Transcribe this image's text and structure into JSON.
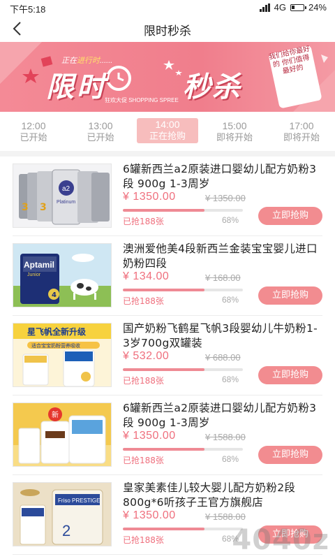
{
  "status_bar": {
    "time": "下午5:18",
    "network": "4G",
    "battery": "24%",
    "battery_level": 0.24
  },
  "header": {
    "title": "限时秒杀",
    "back_icon": "chevron-left-icon"
  },
  "banner": {
    "subtitle_prefix": "正在",
    "subtitle_hl": "进行时",
    "subtitle_suffix": "......",
    "big_left": "限时",
    "big_right": "秒杀",
    "tagline": "狂欢大促 SHOPPING SPREE",
    "side_text": "我们给你最好的 你们值得最好的"
  },
  "tabs": [
    {
      "time": "12:00",
      "status": "已开始",
      "active": false
    },
    {
      "time": "13:00",
      "status": "已开始",
      "active": false
    },
    {
      "time": "14:00",
      "status": "正在抢购",
      "active": true
    },
    {
      "time": "15:00",
      "status": "即将开始",
      "active": false
    },
    {
      "time": "17:00",
      "status": "即将开始",
      "active": false
    }
  ],
  "products": [
    {
      "title": "6罐新西兰a2原装进口婴幼儿配方奶粉3段 900g 1-3周岁",
      "price": "¥ 1350.00",
      "original_price": "¥ 1350.00",
      "sold": "已抢188张",
      "percent": "68%",
      "progress": 0.68,
      "button": "立即抢购"
    },
    {
      "title": "澳洲爱他美4段新西兰金装宝宝婴儿进口奶粉四段",
      "price": "¥ 134.00",
      "original_price": "¥ 168.00",
      "sold": "已抢188张",
      "percent": "68%",
      "progress": 0.68,
      "button": "立即抢购"
    },
    {
      "title": "国产奶粉飞鹤星飞帆3段婴幼儿牛奶粉1-3岁700g双罐装",
      "price": "¥ 532.00",
      "original_price": "¥ 688.00",
      "sold": "已抢188张",
      "percent": "68%",
      "progress": 0.68,
      "button": "立即抢购"
    },
    {
      "title": "6罐新西兰a2原装进口婴幼儿配方奶粉3段 900g 1-3周岁",
      "price": "¥ 1350.00",
      "original_price": "¥ 1588.00",
      "sold": "已抢188张",
      "percent": "68%",
      "progress": 0.68,
      "button": "立即抢购"
    },
    {
      "title": "皇家美素佳儿较大婴儿配方奶粉2段800g*6听孩子王官方旗舰店",
      "price": "¥ 1350.00",
      "original_price": "¥ 1588.00",
      "sold": "已抢188张",
      "percent": "68%",
      "progress": 0.68,
      "button": "立即抢购"
    }
  ],
  "thumb_labels": {
    "p1": "a2",
    "p1_sub": "Platinum",
    "p2": "Aptamil",
    "p2_sub": "Junior",
    "p2_num": "4",
    "p3_head": "星飞帆全新升级",
    "p3_sub": "适合宝宝奶粉营养吸收",
    "p4_badge": "新",
    "p5": "Friso PRESTIGE",
    "p5_num": "2"
  },
  "watermark": "4040z",
  "colors": {
    "accent": "#ef6f7d",
    "button": "#f28c90",
    "active_tab": "#f7bdbd",
    "banner": "#f07e8c"
  }
}
